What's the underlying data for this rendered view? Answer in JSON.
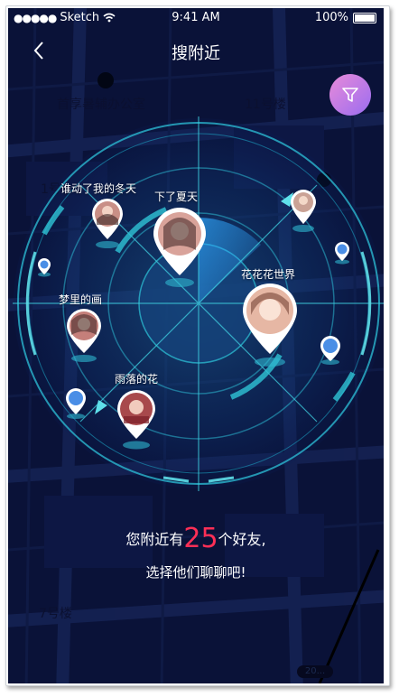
{
  "status_bar": {
    "signal": "●●●●●",
    "carrier": "Sketch",
    "time": "9:41 AM",
    "battery": "100%"
  },
  "nav": {
    "title": "搜附近"
  },
  "map_labels": [
    "首享暑辅办公室",
    "11号楼",
    "1号",
    "7号楼",
    "20..."
  ],
  "friends": [
    {
      "name": "谁动了我的冬天",
      "color": "#c98f86"
    },
    {
      "name": "下了夏天",
      "color": "#d9a39a"
    },
    {
      "name": "花花花世界",
      "color": "#e6b7a4"
    },
    {
      "name": "梦里的画",
      "color": "#c57f7a"
    },
    {
      "name": "雨落的花",
      "color": "#a8494c"
    },
    {
      "name": "",
      "color": "#caa295"
    }
  ],
  "footer": {
    "prefix": "您附近有",
    "count": "25",
    "suffix": "个好友,",
    "line2": "选择他们聊聊吧!"
  },
  "colors": {
    "accent": "#ff2f56",
    "radar": "#3fd0e0",
    "background": "#07103a"
  }
}
